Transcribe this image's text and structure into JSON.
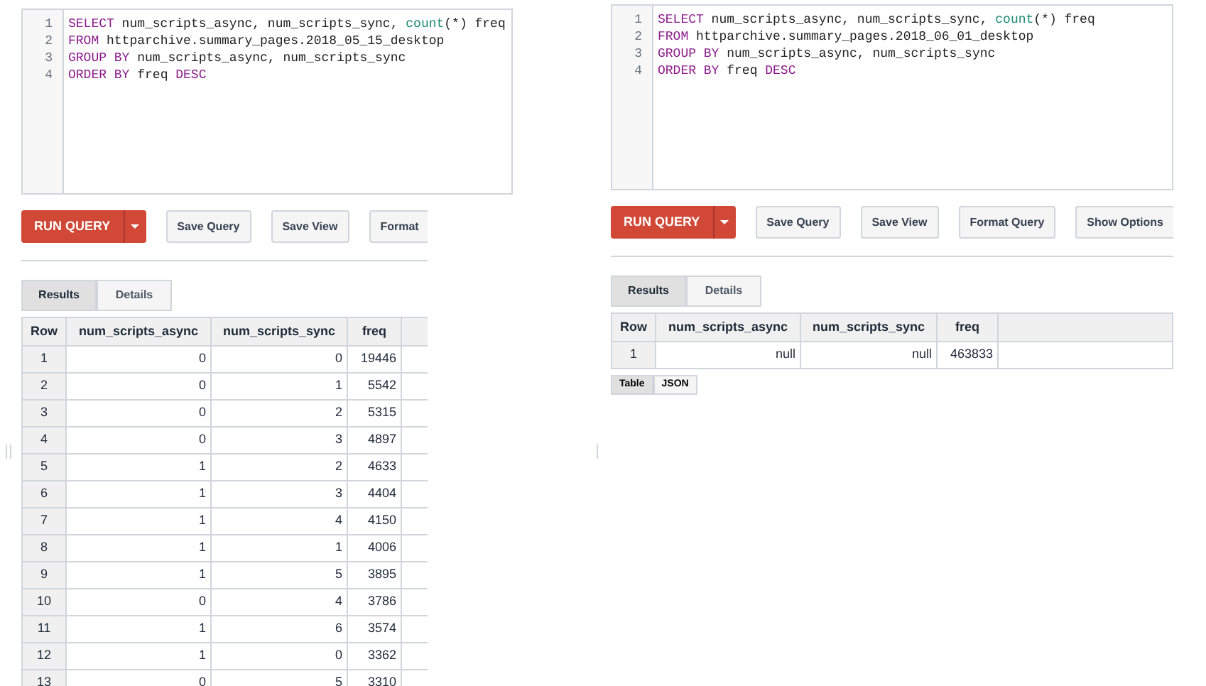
{
  "panels": [
    {
      "editor": {
        "lines": [
          [
            {
              "kind": "keyword",
              "text": "SELECT"
            },
            {
              "kind": "plain",
              "text": " num_scripts_async, num_scripts_sync, "
            },
            {
              "kind": "function",
              "text": "count"
            },
            {
              "kind": "plain",
              "text": "(*) freq"
            }
          ],
          [
            {
              "kind": "keyword",
              "text": "FROM"
            },
            {
              "kind": "plain",
              "text": " httparchive.summary_pages.2018_05_15_desktop"
            }
          ],
          [
            {
              "kind": "keyword",
              "text": "GROUP BY"
            },
            {
              "kind": "plain",
              "text": " num_scripts_async, num_scripts_sync"
            }
          ],
          [
            {
              "kind": "keyword",
              "text": "ORDER BY"
            },
            {
              "kind": "plain",
              "text": " freq "
            },
            {
              "kind": "keyword",
              "text": "DESC"
            }
          ]
        ]
      },
      "line_numbers": [
        "1",
        "2",
        "3",
        "4"
      ],
      "run_button": "RUN QUERY",
      "buttons": [
        "Save Query",
        "Save View",
        "Format"
      ],
      "tabs": [
        {
          "label": "Results",
          "selected": true
        },
        {
          "label": "Details",
          "selected": false
        }
      ],
      "table": {
        "columns": [
          "Row",
          "num_scripts_async",
          "num_scripts_sync",
          "freq"
        ],
        "rows": [
          [
            "1",
            "0",
            "0",
            "19446"
          ],
          [
            "2",
            "0",
            "1",
            "5542"
          ],
          [
            "3",
            "0",
            "2",
            "5315"
          ],
          [
            "4",
            "0",
            "3",
            "4897"
          ],
          [
            "5",
            "1",
            "2",
            "4633"
          ],
          [
            "6",
            "1",
            "3",
            "4404"
          ],
          [
            "7",
            "1",
            "4",
            "4150"
          ],
          [
            "8",
            "1",
            "1",
            "4006"
          ],
          [
            "9",
            "1",
            "5",
            "3895"
          ],
          [
            "10",
            "0",
            "4",
            "3786"
          ],
          [
            "11",
            "1",
            "6",
            "3574"
          ],
          [
            "12",
            "1",
            "0",
            "3362"
          ],
          [
            "13",
            "0",
            "5",
            "3310"
          ]
        ]
      }
    },
    {
      "editor": {
        "lines": [
          [
            {
              "kind": "keyword",
              "text": "SELECT"
            },
            {
              "kind": "plain",
              "text": " num_scripts_async, num_scripts_sync, "
            },
            {
              "kind": "function",
              "text": "count"
            },
            {
              "kind": "plain",
              "text": "(*) freq"
            }
          ],
          [
            {
              "kind": "keyword",
              "text": "FROM"
            },
            {
              "kind": "plain",
              "text": " httparchive.summary_pages.2018_06_01_desktop"
            }
          ],
          [
            {
              "kind": "keyword",
              "text": "GROUP BY"
            },
            {
              "kind": "plain",
              "text": " num_scripts_async, num_scripts_sync"
            }
          ],
          [
            {
              "kind": "keyword",
              "text": "ORDER BY"
            },
            {
              "kind": "plain",
              "text": " freq "
            },
            {
              "kind": "keyword",
              "text": "DESC"
            }
          ]
        ]
      },
      "line_numbers": [
        "1",
        "2",
        "3",
        "4"
      ],
      "run_button": "RUN QUERY",
      "buttons": [
        "Save Query",
        "Save View",
        "Format Query",
        "Show Options"
      ],
      "tabs": [
        {
          "label": "Results",
          "selected": true
        },
        {
          "label": "Details",
          "selected": false
        }
      ],
      "table": {
        "columns": [
          "Row",
          "num_scripts_async",
          "num_scripts_sync",
          "freq"
        ],
        "rows": [
          [
            "1",
            "null",
            "null",
            "463833"
          ]
        ]
      },
      "view_toggle": [
        {
          "label": "Table",
          "selected": true
        },
        {
          "label": "JSON",
          "selected": false
        }
      ]
    }
  ]
}
